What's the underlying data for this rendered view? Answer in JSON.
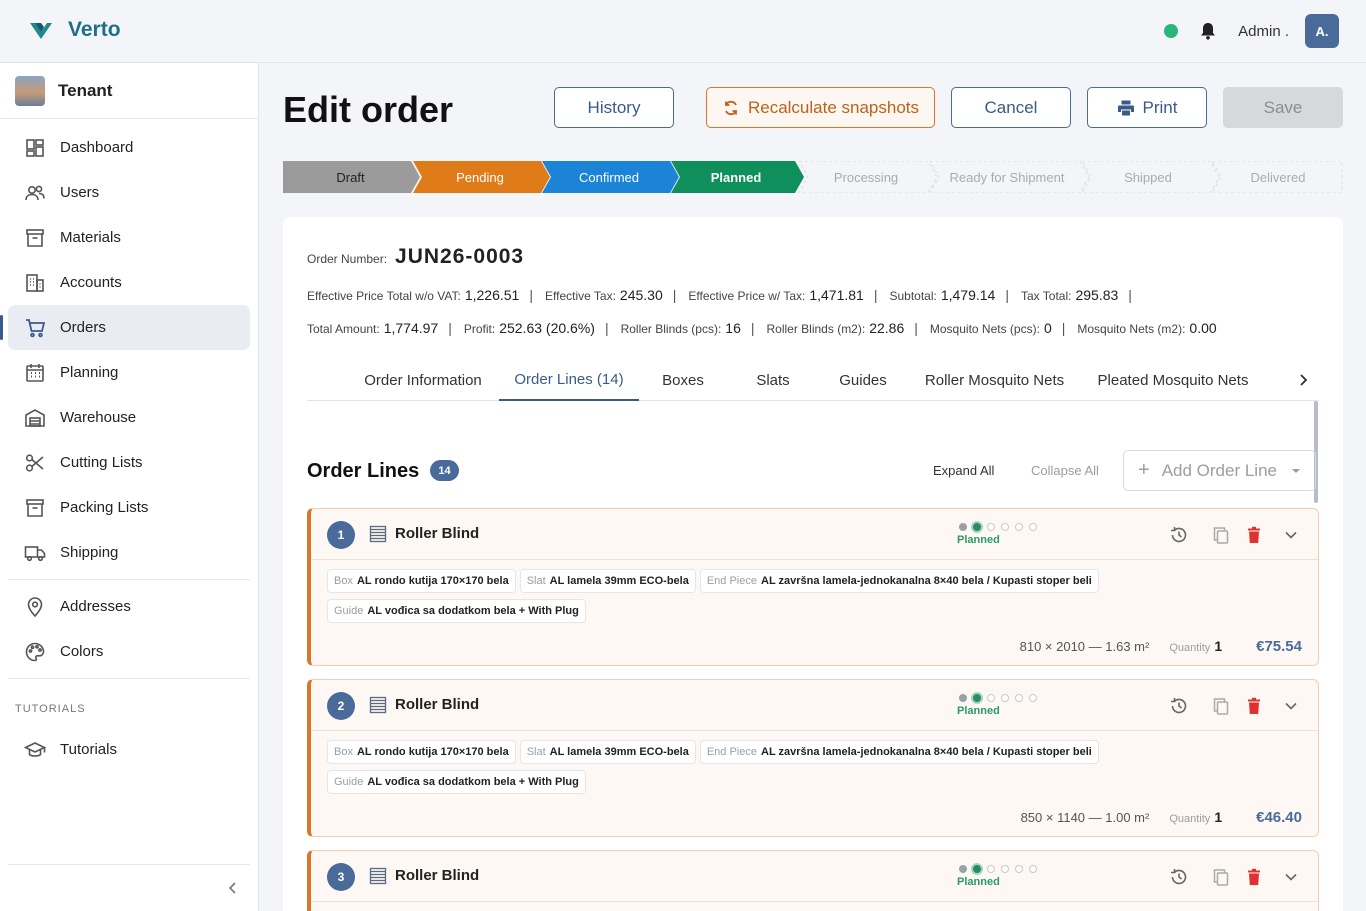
{
  "brand": {
    "name": "Verto"
  },
  "header": {
    "user_name": "Admin .",
    "avatar_initials": "A."
  },
  "sidebar": {
    "tenant": "Tenant",
    "items": [
      {
        "label": "Dashboard",
        "icon": "dashboard-icon"
      },
      {
        "label": "Users",
        "icon": "users-icon"
      },
      {
        "label": "Materials",
        "icon": "archive-icon"
      },
      {
        "label": "Accounts",
        "icon": "building-icon"
      },
      {
        "label": "Orders",
        "icon": "cart-icon",
        "active": true
      },
      {
        "label": "Planning",
        "icon": "calendar-icon"
      },
      {
        "label": "Warehouse",
        "icon": "warehouse-icon"
      },
      {
        "label": "Cutting Lists",
        "icon": "scissors-icon"
      },
      {
        "label": "Packing Lists",
        "icon": "archive-icon"
      },
      {
        "label": "Shipping",
        "icon": "truck-icon"
      }
    ],
    "items2": [
      {
        "label": "Addresses",
        "icon": "map-pin-icon"
      },
      {
        "label": "Colors",
        "icon": "palette-icon"
      }
    ],
    "section_label": "TUTORIALS",
    "items3": [
      {
        "label": "Tutorials",
        "icon": "graduation-cap-icon"
      }
    ]
  },
  "page": {
    "title": "Edit order",
    "buttons": {
      "history": "History",
      "recalc": "Recalculate snapshots",
      "cancel": "Cancel",
      "print": "Print",
      "save": "Save"
    }
  },
  "steps": [
    {
      "label": "Draft",
      "state": "done",
      "color": "#9b9b9b"
    },
    {
      "label": "Pending",
      "state": "done",
      "color": "#e07b1a"
    },
    {
      "label": "Confirmed",
      "state": "done",
      "color": "#1b84d6"
    },
    {
      "label": "Planned",
      "state": "current",
      "color": "#0f8f5c"
    },
    {
      "label": "Processing",
      "state": "todo"
    },
    {
      "label": "Ready for Shipment",
      "state": "todo"
    },
    {
      "label": "Shipped",
      "state": "todo"
    },
    {
      "label": "Delivered",
      "state": "todo"
    }
  ],
  "order": {
    "number_label": "Order Number:",
    "number": "JUN26-0003",
    "metrics_row1": [
      {
        "label": "Effective Price Total w/o VAT:",
        "value": "1,226.51"
      },
      {
        "label": "Effective Tax:",
        "value": "245.30"
      },
      {
        "label": "Effective Price w/ Tax:",
        "value": "1,471.81"
      },
      {
        "label": "Subtotal:",
        "value": "1,479.14"
      },
      {
        "label": "Tax Total:",
        "value": "295.83"
      }
    ],
    "metrics_row2": [
      {
        "label": "Total Amount:",
        "value": "1,774.97"
      },
      {
        "label": "Profit:",
        "value": "252.63 (20.6%)"
      },
      {
        "label": "Roller Blinds (pcs):",
        "value": "16"
      },
      {
        "label": "Roller Blinds (m2):",
        "value": "22.86"
      },
      {
        "label": "Mosquito Nets (pcs):",
        "value": "0"
      },
      {
        "label": "Mosquito Nets (m2):",
        "value": "0.00"
      }
    ]
  },
  "tabs": [
    {
      "label": "Order Information"
    },
    {
      "label": "Order Lines (14)",
      "active": true
    },
    {
      "label": "Boxes"
    },
    {
      "label": "Slats"
    },
    {
      "label": "Guides"
    },
    {
      "label": "Roller Mosquito Nets"
    },
    {
      "label": "Pleated Mosquito Nets"
    }
  ],
  "order_lines": {
    "title": "Order Lines",
    "count": "14",
    "expand_all": "Expand All",
    "collapse_all": "Collapse All",
    "add_label": "Add Order Line",
    "lines": [
      {
        "num": "1",
        "title": "Roller Blind",
        "status": "Planned",
        "tags": [
          {
            "k": "Box",
            "v": "AL rondo kutija 170×170 bela"
          },
          {
            "k": "Slat",
            "v": "AL lamela 39mm ECO-bela"
          },
          {
            "k": "End Piece",
            "v": "AL završna lamela-jednokanalna 8×40 bela / Kupasti stoper beli"
          },
          {
            "k": "Guide",
            "v": "AL vođica sa dodatkom bela + With Plug"
          }
        ],
        "dims": "810 × 2010 — 1.63 m²",
        "qty_label": "Quantity",
        "qty": "1",
        "price": "€75.54"
      },
      {
        "num": "2",
        "title": "Roller Blind",
        "status": "Planned",
        "tags": [
          {
            "k": "Box",
            "v": "AL rondo kutija 170×170 bela"
          },
          {
            "k": "Slat",
            "v": "AL lamela 39mm ECO-bela"
          },
          {
            "k": "End Piece",
            "v": "AL završna lamela-jednokanalna 8×40 bela / Kupasti stoper beli"
          },
          {
            "k": "Guide",
            "v": "AL vođica sa dodatkom bela + With Plug"
          }
        ],
        "dims": "850 × 1140 — 1.00 m²",
        "qty_label": "Quantity",
        "qty": "1",
        "price": "€46.40"
      },
      {
        "num": "3",
        "title": "Roller Blind",
        "status": "Planned"
      }
    ]
  }
}
